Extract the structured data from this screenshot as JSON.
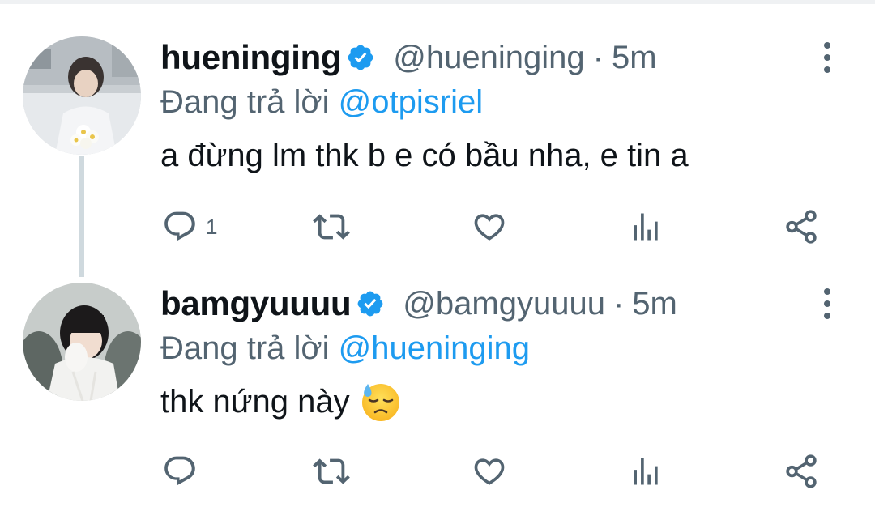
{
  "tweets": [
    {
      "name": "hueninging",
      "handle": "@hueninging",
      "separator": "·",
      "time": "5m",
      "reply_prefix": "Đang trả lời",
      "reply_to": "@otpisriel",
      "text": "a đừng lm thk b e có bầu nha, e tin a",
      "reply_count": "1"
    },
    {
      "name": "bamgyuuuu",
      "handle": "@bamgyuuuu",
      "separator": "·",
      "time": "5m",
      "reply_prefix": "Đang trả lời",
      "reply_to": "@hueninging",
      "text": "thk nứng này",
      "emoji": "downcast-face-with-sweat",
      "reply_count": ""
    }
  ],
  "icons": [
    "reply-icon",
    "retweet-icon",
    "like-icon",
    "analytics-icon",
    "share-icon",
    "more-icon",
    "verified-icon"
  ],
  "colors": {
    "accent": "#1d9bf0",
    "secondary_text": "#536471",
    "primary_text": "#0f1419",
    "thread_line": "#cfd9de"
  }
}
